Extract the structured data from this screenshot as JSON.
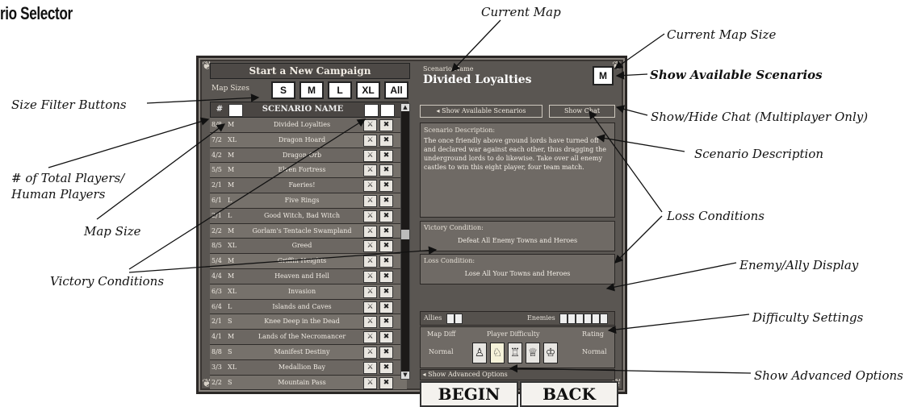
{
  "page_title": "rio Selector",
  "callouts": {
    "current_map": "Current Map",
    "current_map_size": "Current Map Size",
    "show_available": "Show Available Scenarios",
    "size_filter": "Size Filter Buttons",
    "show_hide_chat": "Show/Hide Chat (Multiplayer Only)",
    "total_players_1": "# of Total Players/",
    "total_players_2": "Human Players",
    "scenario_description": "Scenario Description",
    "loss_conditions": "Loss Conditions",
    "map_size": "Map Size",
    "enemy_ally": "Enemy/Ally Display",
    "victory_conditions": "Victory Conditions",
    "difficulty_settings": "Difficulty Settings",
    "show_advanced": "Show Advanced Options"
  },
  "game": {
    "campaign_title": "Start a New Campaign",
    "map_sizes_label": "Map Sizes",
    "size_buttons": [
      "S",
      "M",
      "L",
      "XL",
      "All"
    ],
    "header": {
      "players": "#",
      "name": "SCENARIO NAME"
    },
    "scenarios": [
      {
        "players": "8/8",
        "size": "M",
        "name": "Divided Loyalties"
      },
      {
        "players": "7/2",
        "size": "XL",
        "name": "Dragon Hoard"
      },
      {
        "players": "4/2",
        "size": "M",
        "name": "Dragon Orb"
      },
      {
        "players": "5/5",
        "size": "M",
        "name": "Elven Fortress"
      },
      {
        "players": "2/1",
        "size": "M",
        "name": "Faeries!"
      },
      {
        "players": "6/1",
        "size": "L",
        "name": "Five Rings"
      },
      {
        "players": "2/1",
        "size": "L",
        "name": "Good Witch, Bad Witch"
      },
      {
        "players": "2/2",
        "size": "M",
        "name": "Gorlam's Tentacle Swampland"
      },
      {
        "players": "8/5",
        "size": "XL",
        "name": "Greed"
      },
      {
        "players": "5/4",
        "size": "M",
        "name": "Griffin Heights"
      },
      {
        "players": "4/4",
        "size": "M",
        "name": "Heaven and Hell"
      },
      {
        "players": "6/3",
        "size": "XL",
        "name": "Invasion"
      },
      {
        "players": "6/4",
        "size": "L",
        "name": "Islands and Caves"
      },
      {
        "players": "2/1",
        "size": "S",
        "name": "Knee Deep in the Dead"
      },
      {
        "players": "4/1",
        "size": "M",
        "name": "Lands of the Necromancer"
      },
      {
        "players": "8/8",
        "size": "S",
        "name": "Manifest Destiny"
      },
      {
        "players": "3/3",
        "size": "XL",
        "name": "Medallion Bay"
      },
      {
        "players": "2/2",
        "size": "S",
        "name": "Mountain Pass"
      }
    ],
    "scenario_name_label": "Scenario Name",
    "scenario_name": "Divided Loyalties",
    "current_map_size": "M",
    "show_available_btn": "Show Available Scenarios",
    "show_chat_btn": "Show Chat",
    "description_label": "Scenario Description:",
    "description": "The once friendly above ground lords have turned off and declared war against each other, thus dragging the underground lords to do likewise. Take over all enemy castles to win this eight player, four team match.",
    "victory_label": "Victory Condition:",
    "victory": "Defeat All Enemy Towns and Heroes",
    "loss_label": "Loss Condition:",
    "loss": "Lose All Your Towns and Heroes",
    "allies_label": "Allies",
    "enemies_label": "Enemies",
    "map_diff_label": "Map Diff",
    "player_diff_label": "Player Difficulty",
    "rating_label": "Rating",
    "map_diff_value": "Normal",
    "rating_value": "Normal",
    "advanced_btn": "Show Advanced Options",
    "begin": "BEGIN",
    "back": "BACK"
  }
}
